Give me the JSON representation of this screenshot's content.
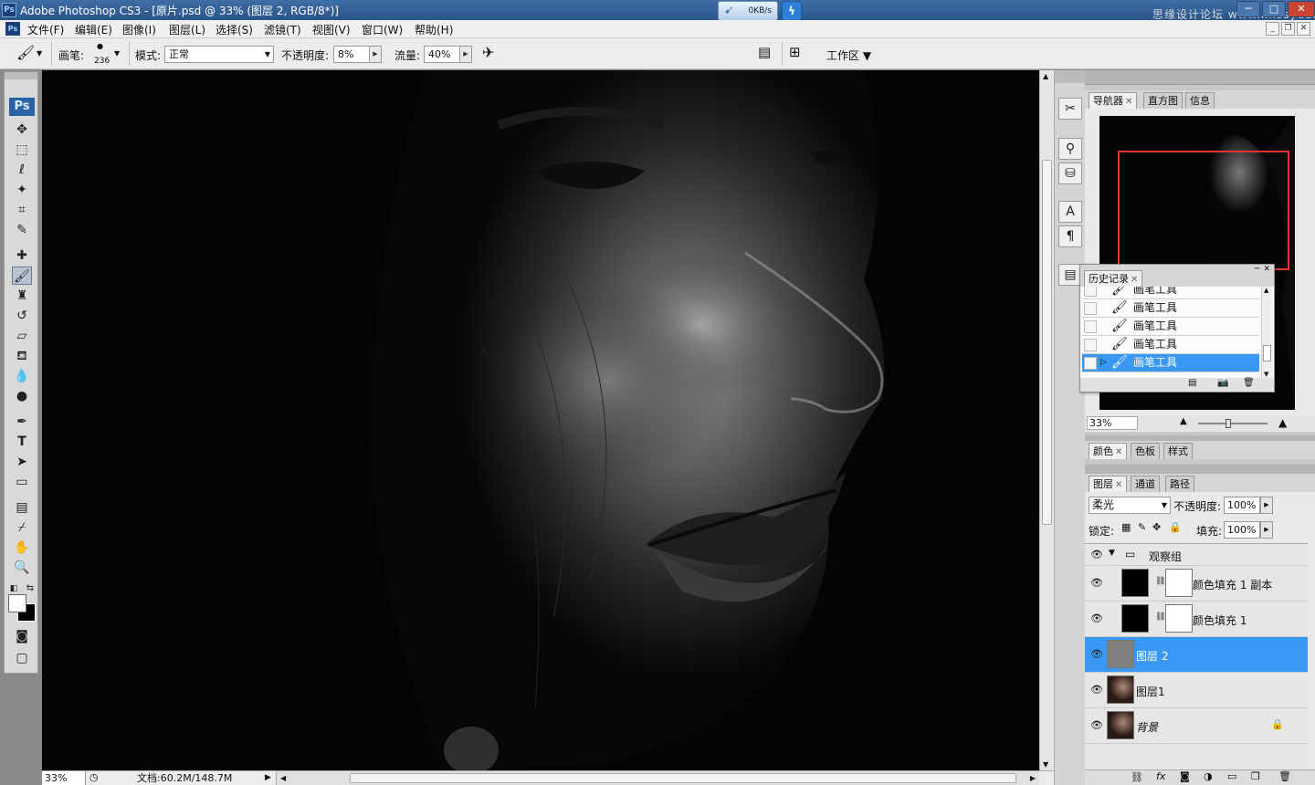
{
  "window": {
    "title": "Adobe Photoshop CS3 - [原片.psd @ 33% (图层 2, RGB/8*)]",
    "net_speed": "0KB/s",
    "watermark": "思缘设计论坛 www.missyuan.com"
  },
  "menu": [
    "文件(F)",
    "编辑(E)",
    "图像(I)",
    "图层(L)",
    "选择(S)",
    "滤镜(T)",
    "视图(V)",
    "窗口(W)",
    "帮助(H)"
  ],
  "options": {
    "brush_label": "画笔:",
    "brush_size": "236",
    "mode_label": "模式:",
    "mode_value": "正常",
    "opacity_label": "不透明度:",
    "opacity_value": "8%",
    "flow_label": "流量:",
    "flow_value": "40%",
    "workspace": "工作区"
  },
  "status": {
    "zoom": "33%",
    "doc": "文档:60.2M/148.7M"
  },
  "navigator": {
    "tabs": [
      "导航器",
      "直方图",
      "信息"
    ],
    "zoom": "33%"
  },
  "history": {
    "tab": "历史记录",
    "items": [
      "画笔工具",
      "画笔工具",
      "画笔工具",
      "画笔工具",
      "画笔工具"
    ],
    "selected_index": 4
  },
  "color_panel": {
    "tabs": [
      "颜色",
      "色板",
      "样式"
    ]
  },
  "layers_panel": {
    "tabs": [
      "图层",
      "通道",
      "路径"
    ],
    "blend_mode": "柔光",
    "opacity_label": "不透明度:",
    "opacity_value": "100%",
    "lock_label": "锁定:",
    "fill_label": "填充:",
    "fill_value": "100%",
    "layers": [
      {
        "name": "观察组",
        "type": "group"
      },
      {
        "name": "颜色填充 1 副本",
        "type": "fill"
      },
      {
        "name": "颜色填充 1",
        "type": "fill"
      },
      {
        "name": "图层 2",
        "type": "pixel",
        "selected": true
      },
      {
        "name": "图层1",
        "type": "pixel"
      },
      {
        "name": "背景",
        "type": "background"
      }
    ]
  }
}
